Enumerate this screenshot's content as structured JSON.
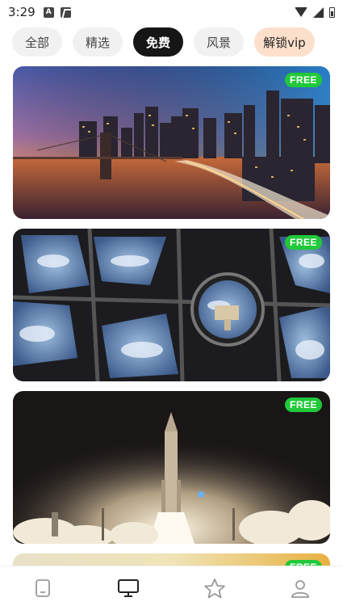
{
  "status_bar": {
    "time": "3:29",
    "notification_a": "A"
  },
  "tabs": [
    {
      "label": "全部",
      "active": false
    },
    {
      "label": "精选",
      "active": false
    },
    {
      "label": "免费",
      "active": true
    },
    {
      "label": "风景",
      "active": false
    },
    {
      "label": "解锁vip",
      "active": false
    }
  ],
  "cards": [
    {
      "subject": "city-skyline-sunset",
      "badge": "FREE"
    },
    {
      "subject": "space-station-window",
      "badge": "FREE"
    },
    {
      "subject": "rocket-launch-night",
      "badge": "FREE"
    },
    {
      "subject": "partial-card",
      "badge": "FREE"
    }
  ],
  "bottom_nav": [
    {
      "icon": "phone-icon",
      "active": false
    },
    {
      "icon": "monitor-icon",
      "active": true
    },
    {
      "icon": "star-icon",
      "active": false
    },
    {
      "icon": "profile-icon",
      "active": false
    }
  ],
  "colors": {
    "active_tab": "#161616",
    "vip_tab": "#fde0cc",
    "free_badge": "#20c93a"
  }
}
